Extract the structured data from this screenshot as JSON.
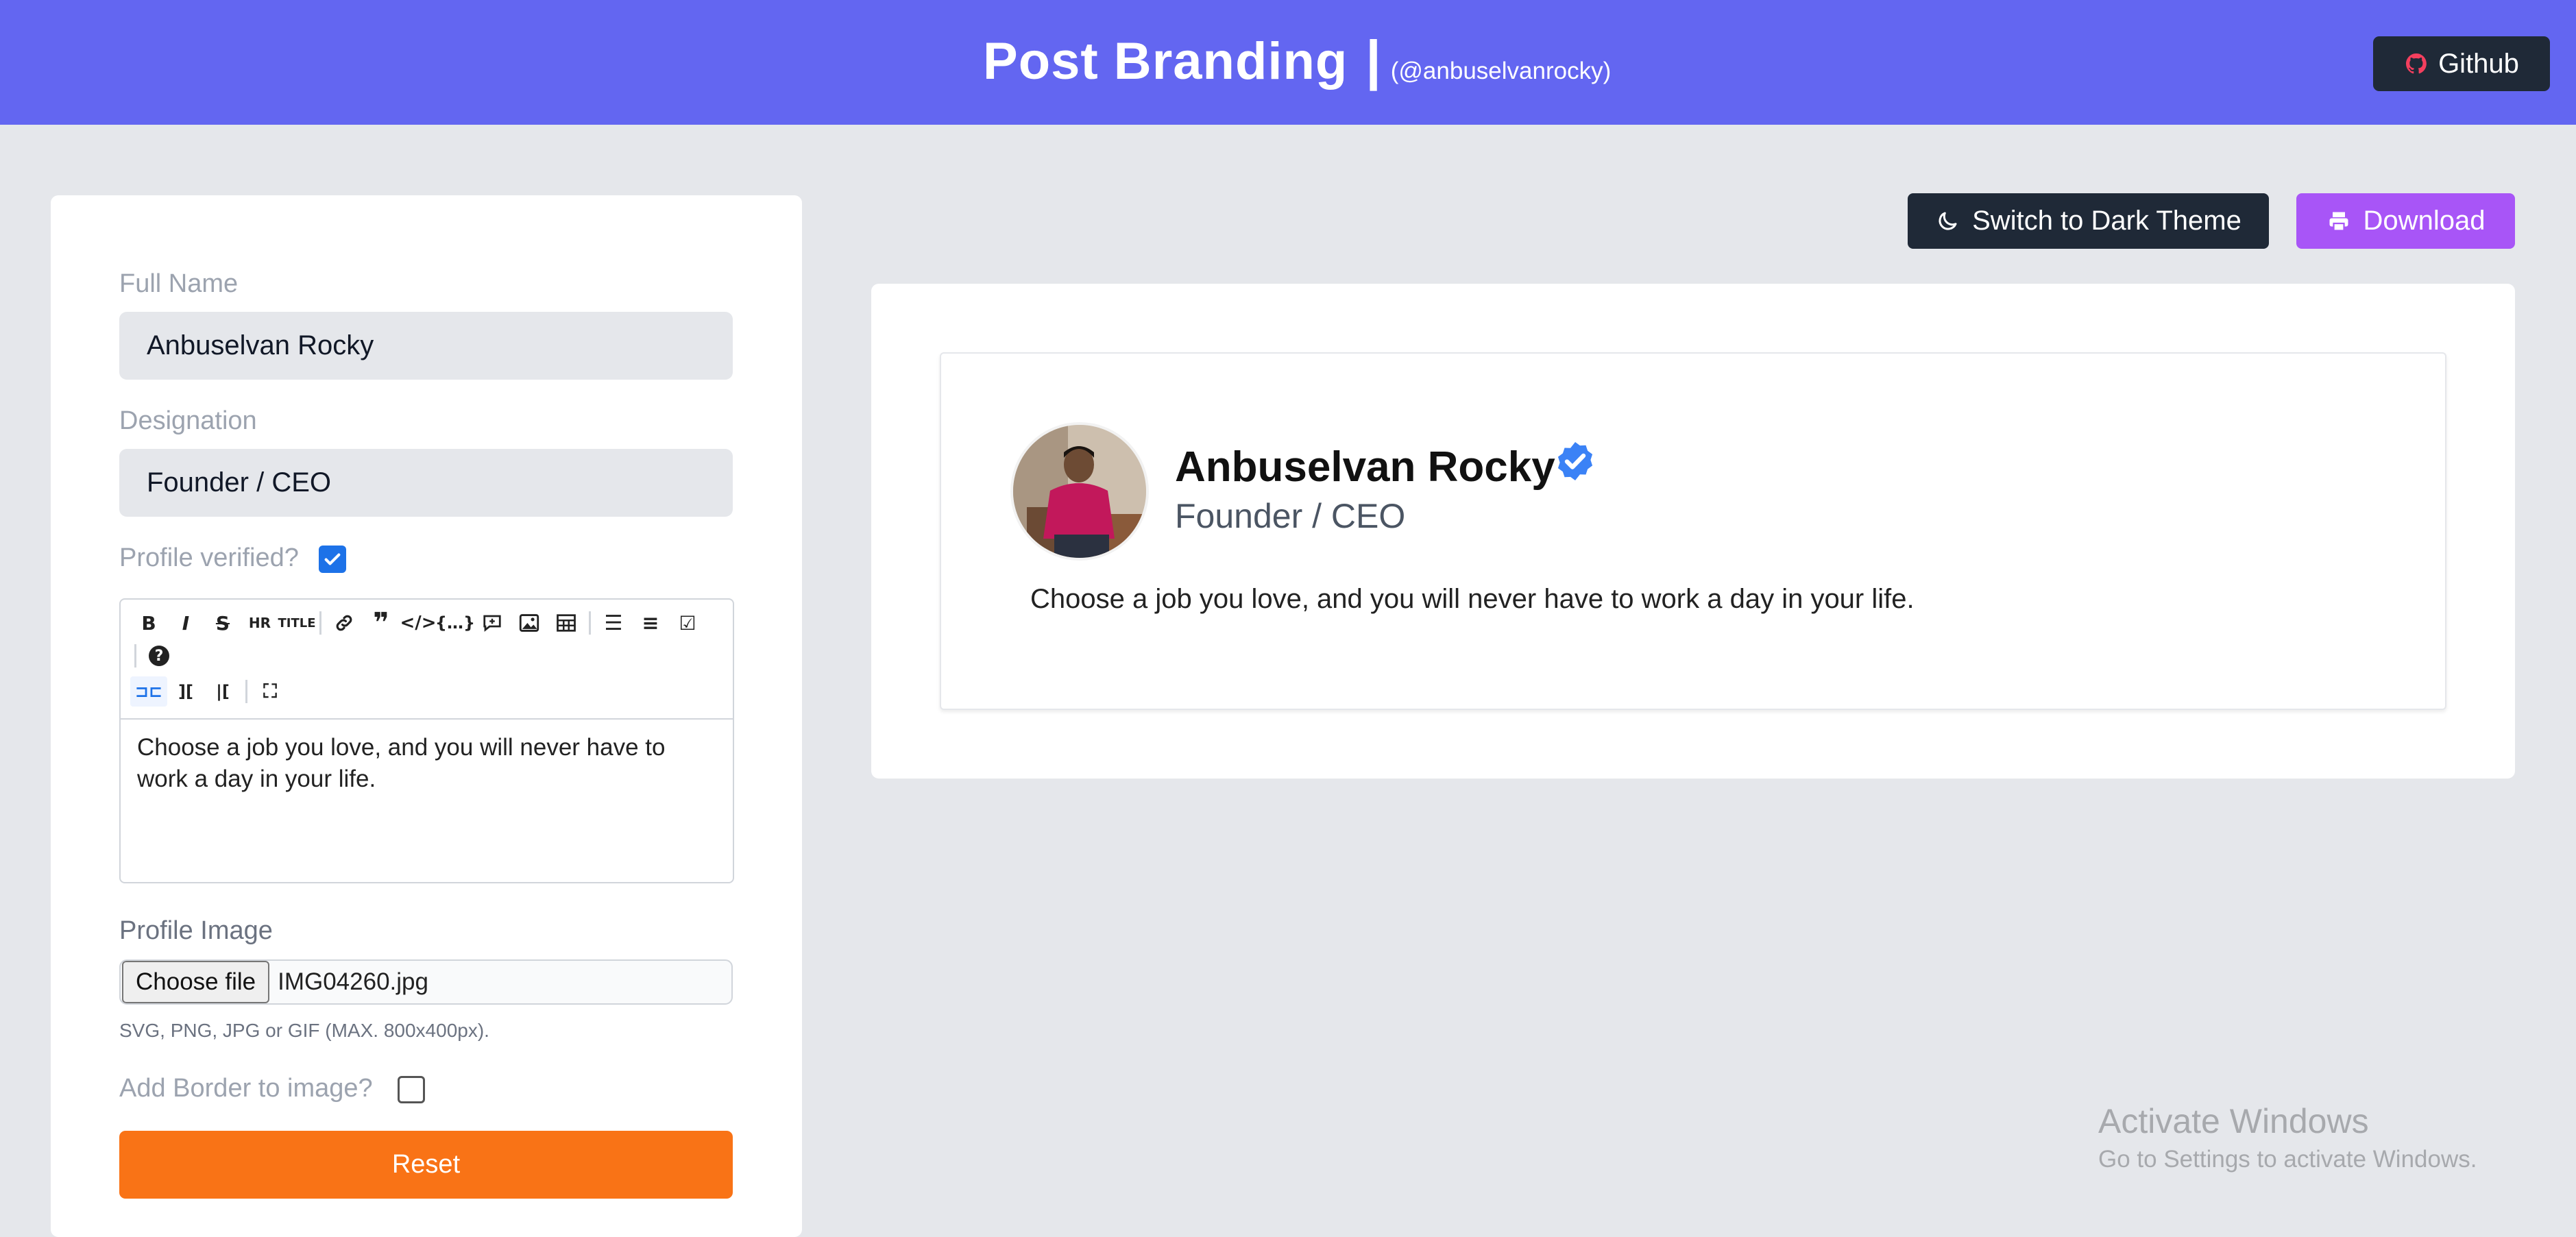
{
  "header": {
    "title": "Post Branding",
    "separator": "|",
    "handle": "(@anbuselvanrocky)",
    "github_label": "Github"
  },
  "form": {
    "full_name_label": "Full Name",
    "full_name_value": "Anbuselvan Rocky",
    "designation_label": "Designation",
    "designation_value": "Founder / CEO",
    "verified_label": "Profile verified?",
    "verified_checked": true,
    "editor_text": "Choose a job you love, and you will never have to work a day in your life.",
    "profile_image_label": "Profile Image",
    "choose_file_label": "Choose file",
    "file_name": "IMG04260.jpg",
    "file_hint": "SVG, PNG, JPG or GIF (MAX. 800x400px).",
    "border_label": "Add Border to image?",
    "border_checked": false,
    "reset_label": "Reset"
  },
  "toolbar": {
    "icons": [
      "bold-icon",
      "italic-icon",
      "strikethrough-icon",
      "horizontal-rule-icon",
      "title-icon",
      "link-icon",
      "quote-icon",
      "code-icon",
      "code-block-icon",
      "comment-icon",
      "image-icon",
      "table-icon",
      "unordered-list-icon",
      "ordered-list-icon",
      "checklist-icon",
      "help-icon",
      "edit-mode-icon",
      "live-mode-icon",
      "preview-mode-icon",
      "fullscreen-icon"
    ]
  },
  "actions": {
    "theme_label": "Switch to Dark Theme",
    "download_label": "Download"
  },
  "preview": {
    "name": "Anbuselvan Rocky",
    "designation": "Founder / CEO",
    "text": "Choose a job you love, and you will never have to work a day in your life."
  },
  "watermark": {
    "title": "Activate Windows",
    "subtitle": "Go to Settings to activate Windows."
  },
  "colors": {
    "header": "#6366f1",
    "reset": "#f97316",
    "download": "#a855f7",
    "dark": "#1f2937",
    "verified": "#3b82f6"
  }
}
